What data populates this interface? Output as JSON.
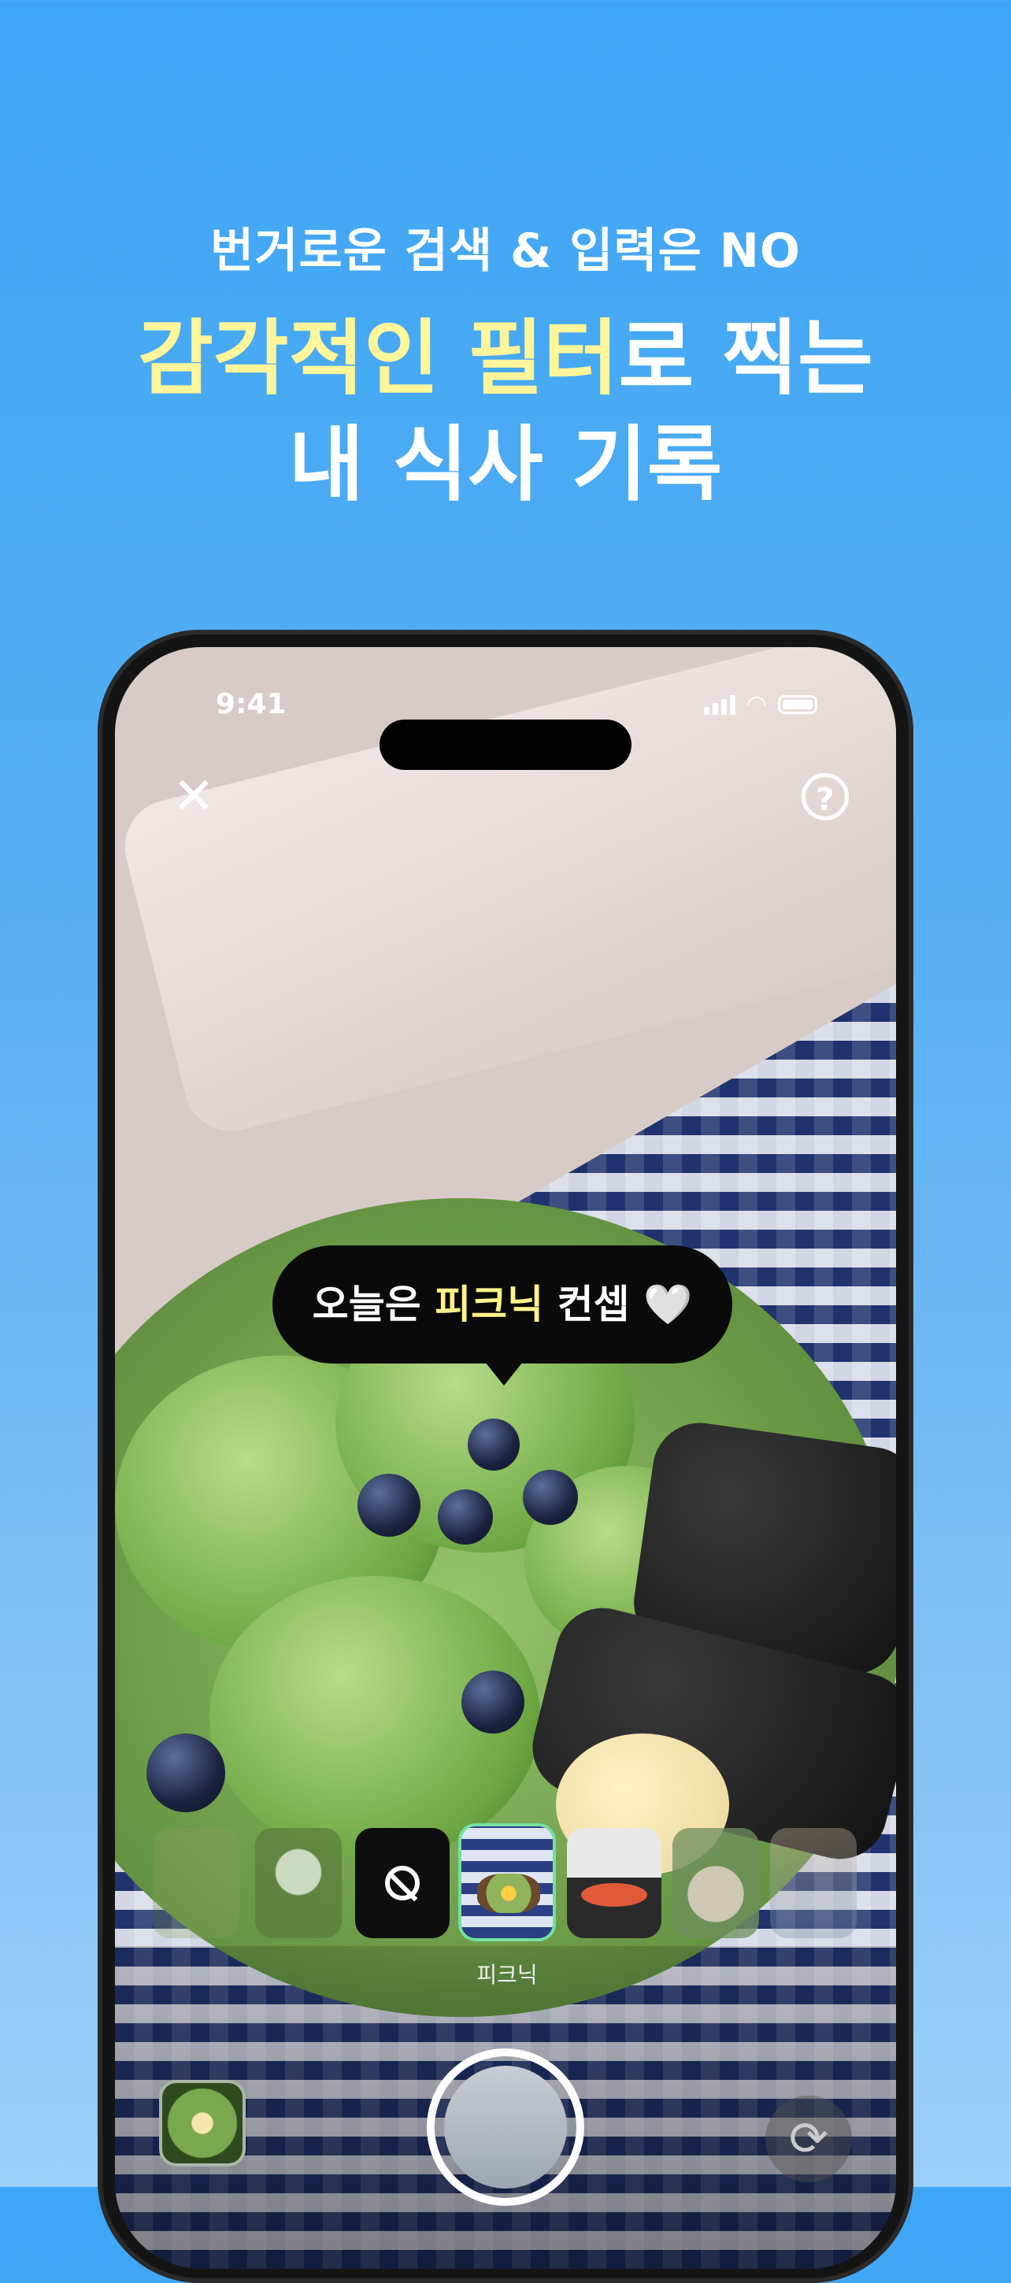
{
  "marketing": {
    "subtitle": "번거로운 검색 & 입력은 NO",
    "title_line1_highlight1": "감각적인",
    "title_line1_highlight2": "필터",
    "title_line1_rest": "로 찍는",
    "title_line2": "내 식사 기록"
  },
  "status_bar": {
    "time": "9:41"
  },
  "camera": {
    "close_icon": "close-icon",
    "help_icon": "help-icon",
    "help_glyph": "?",
    "tooltip": {
      "prefix": "오늘은 ",
      "highlight": "피크닉",
      "suffix": " 컨셉 ",
      "emoji": "🤍"
    },
    "filters": [
      {
        "name": "filter-faded-1",
        "selected": false
      },
      {
        "name": "filter-faded-2",
        "selected": false
      },
      {
        "name": "filter-none",
        "selected": false
      },
      {
        "name": "filter-picnic",
        "selected": true,
        "label": "피크닉"
      },
      {
        "name": "filter-3",
        "selected": false
      },
      {
        "name": "filter-4",
        "selected": false
      },
      {
        "name": "filter-5",
        "selected": false
      }
    ],
    "selected_filter_label": "피크닉",
    "flip_icon": "flip-camera-icon",
    "flip_glyph": "⟳"
  },
  "colors": {
    "background": "#3EA6F6",
    "highlight_yellow": "#FFF59A",
    "selected_border": "#74E0A0"
  }
}
